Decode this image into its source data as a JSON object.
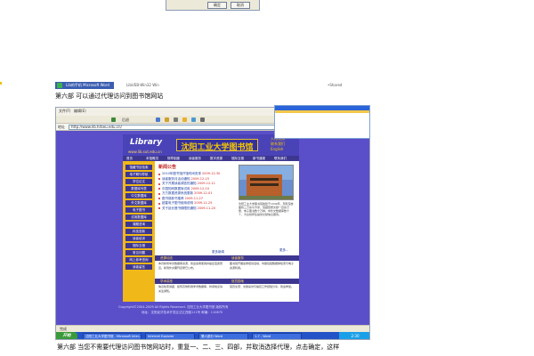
{
  "top_dialog": {
    "ok_label": "确定",
    "cancel_label": "取消"
  },
  "strip": {
    "title": "Lib的手机 Microsoft Word",
    "middle": "LibUSB-Win32 Win",
    "right": "•Shared"
  },
  "captions": {
    "part6_top": "第六部 可以通过代理访问到图书馆网站",
    "part6_bottom": "第六部 当您不需要代理访问图书馆网站时，重复一、二、三、四部，并取消选择代理，点击确定，这样"
  },
  "ie": {
    "menu": [
      "文件(F)",
      "编辑(E)"
    ],
    "back_label": "后退",
    "address_label": "地址",
    "address_value": "http://www.lib.hrbeu.edu.cn/",
    "status_text": "完成",
    "start_label": "开始",
    "tasks": [
      "沈阳工业大学图书馆 - Microsoft Inter...",
      "Internet Explorer",
      "第六部分 Word",
      "1-7 - Word"
    ],
    "tray": "2:30"
  },
  "library": {
    "logo": "Library",
    "url": "www.lib.sut.edu.cn",
    "title": "沈阳工业大学图书馆",
    "right_links": [
      "入馆须知",
      "联系我们",
      "English"
    ],
    "nav": [
      "首页",
      "本馆概况",
      "规章制度",
      "读者服务",
      "数字资源",
      "馆际互借",
      "新书通报",
      "联系我们"
    ],
    "sidebar": [
      "馆藏书目检索",
      "电子期刊导航",
      "学位论文",
      "数据库列表",
      "中文数据库",
      "外文数据库",
      "电子图书",
      "试用数据库",
      "课题咨询",
      "科技查新",
      "读者培训",
      "馆际互借",
      "常见问题",
      "网上参考咨询",
      "读者留言"
    ],
    "news_heading": "新闻公告",
    "news": [
      {
        "title": "2010年图书馆开馆时间安排",
        "date": "2009-12-30"
      },
      {
        "title": "读者服务月活动通知",
        "date": "2009-12-15"
      },
      {
        "title": "关于开展读者调查的通知",
        "date": "2009-12-11"
      },
      {
        "title": "中国知网数据库试用",
        "date": "2009-12-10"
      },
      {
        "title": "万方数据资源系统更新",
        "date": "2009-12-01"
      },
      {
        "title": "图书馆新书推荐",
        "date": "2009-11-27"
      },
      {
        "title": "超星电子图书使用说明",
        "date": "2009-11-25"
      },
      {
        "title": "关于延长借书期限的通知",
        "date": "2009-11-20"
      }
    ],
    "news_more": "更多新闻",
    "intro_text": "沈阳工业大学图书馆始建于1949年，现有馆舍面积三万余平方米，馆藏纸质文献一百余万册，电子图书数十万种，中外文数据库数十个，为全校师生提供文献信息服务。",
    "intro_more": "更多...",
    "bands": [
      {
        "left": "资源动态",
        "right": "读者服务"
      },
      {
        "left": "学术讲座",
        "right": "馆员园地"
      }
    ],
    "col_texts": [
      "本月新增中文数据库资源，欢迎读者使用并提出宝贵意见。新到外文期刊目录已公布。",
      "图书馆开展读者培训活动，内容包括数据库检索与电子资源利用。",
      "信息检索讲座：如何高效利用学术数据库，时间地点请关注通知。",
      "馆员交流：文献采访与编目工作经验分享，欢迎参加。"
    ],
    "footer_lines": [
      "Copyright©2004-2009 All Rights Reserved. 沈阳工业大学图书馆 版权所有",
      "地址：沈阳经济技术开发区沈辽西路111号 邮编：110870"
    ]
  }
}
